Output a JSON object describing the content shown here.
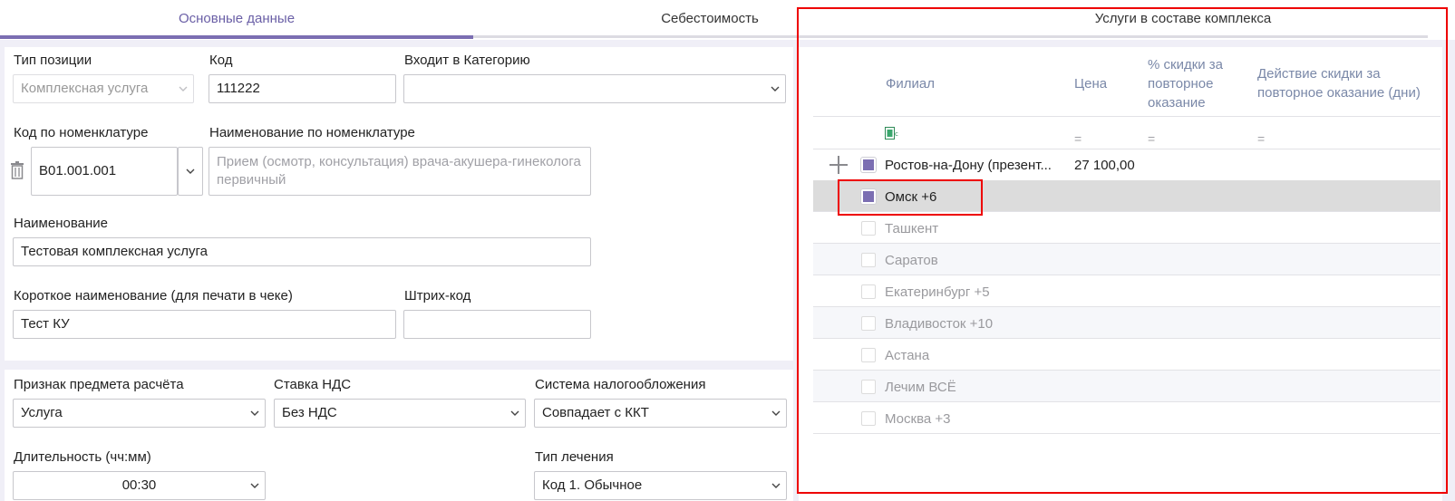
{
  "tabs": [
    {
      "label": "Основные данные"
    },
    {
      "label": "Себестоимость"
    },
    {
      "label": "Услуги в составе комплекса"
    }
  ],
  "form": {
    "type_label": "Тип позиции",
    "type_value": "Комплексная услуга",
    "code_label": "Код",
    "code_value": "111222",
    "category_label": "Входит в Категорию",
    "category_value": "",
    "nom_code_label": "Код по номенклатуре",
    "nom_code_value": "B01.001.001",
    "nom_name_label": "Наименование по номенклатуре",
    "nom_name_placeholder": "Прием (осмотр, консультация) врача-акушера-гинеколога первичный",
    "name_label": "Наименование",
    "name_value": "Тестовая комплексная услуга",
    "short_name_label": "Короткое наименование (для печати в чеке)",
    "short_name_value": "Тест КУ",
    "barcode_label": "Штрих-код",
    "barcode_value": "",
    "payment_label": "Признак предмета расчёта",
    "payment_value": "Услуга",
    "vat_label": "Ставка НДС",
    "vat_value": "Без НДС",
    "tax_label": "Система налогообложения",
    "tax_value": "Совпадает с ККТ",
    "duration_label": "Длительность (чч:мм)",
    "duration_value": "00:30",
    "treatment_label": "Тип лечения",
    "treatment_value": "Код 1. Обычное"
  },
  "table": {
    "headers": {
      "branch": "Филиал",
      "price": "Цена",
      "discount": "% скидки за повторное оказание",
      "discount_days": "Действие скидки за повторное оказание (дни)"
    },
    "filter_symbol": "=",
    "rows": [
      {
        "name": "Ростов-на-Дону (презент...",
        "price": "27 100,00",
        "checked": true
      },
      {
        "name": "Омск +6",
        "price": "",
        "checked": true
      },
      {
        "name": "Ташкент",
        "price": "",
        "checked": false
      },
      {
        "name": "Саратов",
        "price": "",
        "checked": false
      },
      {
        "name": "Екатеринбург +5",
        "price": "",
        "checked": false
      },
      {
        "name": "Владивосток +10",
        "price": "",
        "checked": false
      },
      {
        "name": "Астана",
        "price": "",
        "checked": false
      },
      {
        "name": "Лечим ВСЁ",
        "price": "",
        "checked": false
      },
      {
        "name": "Москва +3",
        "price": "",
        "checked": false
      }
    ]
  },
  "colors": {
    "accent": "#7b6eb2",
    "highlight": "#e00000"
  }
}
